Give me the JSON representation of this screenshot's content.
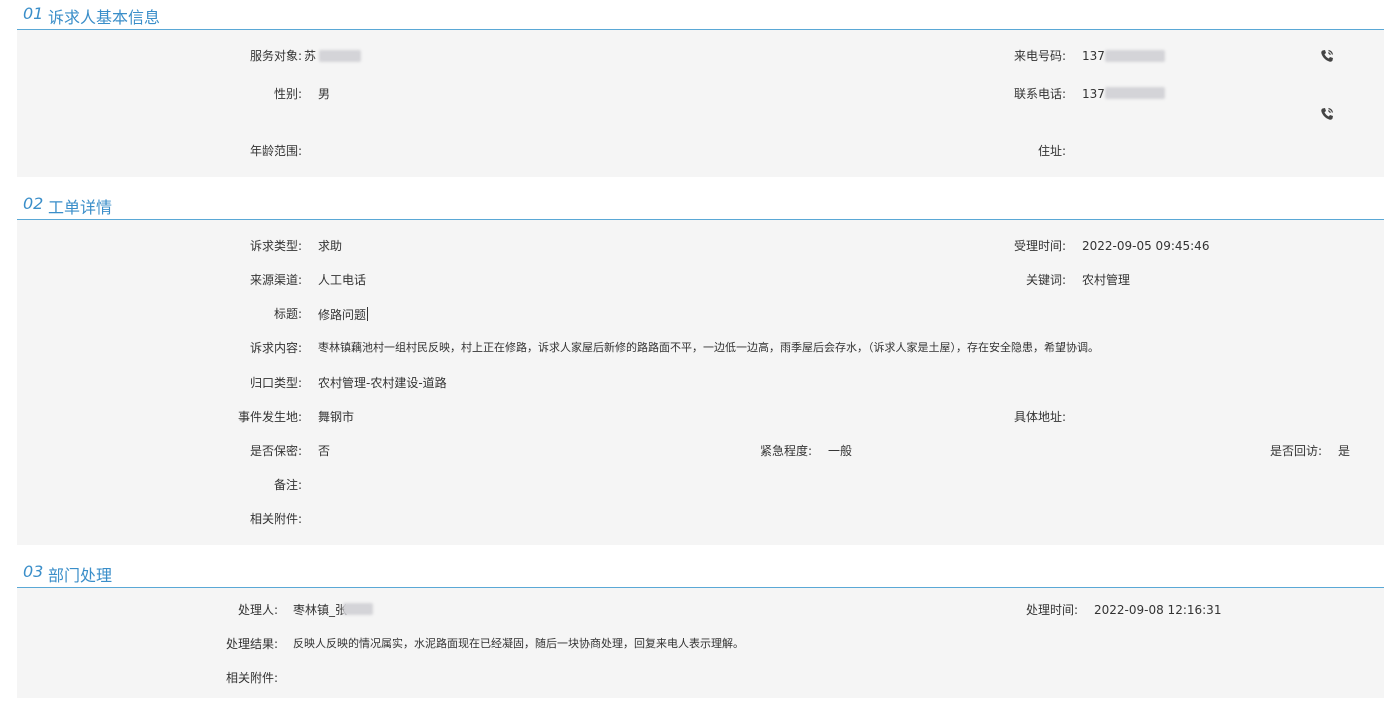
{
  "sections": [
    {
      "num": "01",
      "title": "诉求人基本信息"
    },
    {
      "num": "02",
      "title": "工单详情"
    },
    {
      "num": "03",
      "title": "部门处理"
    }
  ],
  "basic": {
    "service_target_label": "服务对象:",
    "service_target_value": "苏",
    "gender_label": "性别:",
    "gender_value": "男",
    "age_label": "年龄范围:",
    "age_value": "",
    "caller_phone_label": "来电号码:",
    "caller_phone_value": "137",
    "contact_phone_label": "联系电话:",
    "contact_phone_value": "137",
    "address_label": "住址:",
    "address_value": "",
    "phone_icon": "phone-call-icon"
  },
  "order": {
    "type_label": "诉求类型:",
    "type_value": "求助",
    "accept_time_label": "受理时间:",
    "accept_time_value": "2022-09-05 09:45:46",
    "channel_label": "来源渠道:",
    "channel_value": "人工电话",
    "keyword_label": "关键词:",
    "keyword_value": "农村管理",
    "subject_label": "标题:",
    "subject_value": "修路问题",
    "content_label": "诉求内容:",
    "content_value": "枣林镇藕池村一组村民反映，村上正在修路，诉求人家屋后新修的路路面不平，一边低一边高，雨季屋后会存水，（诉求人家是土屋），存在安全隐患，希望协调。",
    "category_label": "归口类型:",
    "category_value": "农村管理-农村建设-道路",
    "location_label": "事件发生地:",
    "location_value": "舞钢市",
    "detail_address_label": "具体地址:",
    "detail_address_value": "",
    "confidential_label": "是否保密:",
    "confidential_value": "否",
    "urgency_label": "紧急程度:",
    "urgency_value": "一般",
    "revisit_label": "是否回访:",
    "revisit_value": "是",
    "remark_label": "备注:",
    "remark_value": "",
    "attachment_label": "相关附件:",
    "attachment_value": ""
  },
  "dept": {
    "handler_label": "处理人:",
    "handler_value": "枣林镇_张",
    "handle_time_label": "处理时间:",
    "handle_time_value": "2022-09-08 12:16:31",
    "result_label": "处理结果:",
    "result_value": "反映人反映的情况属实，水泥路面现在已经凝固，随后一块协商处理，回复来电人表示理解。",
    "attachment_label": "相关附件:",
    "attachment_value": ""
  }
}
